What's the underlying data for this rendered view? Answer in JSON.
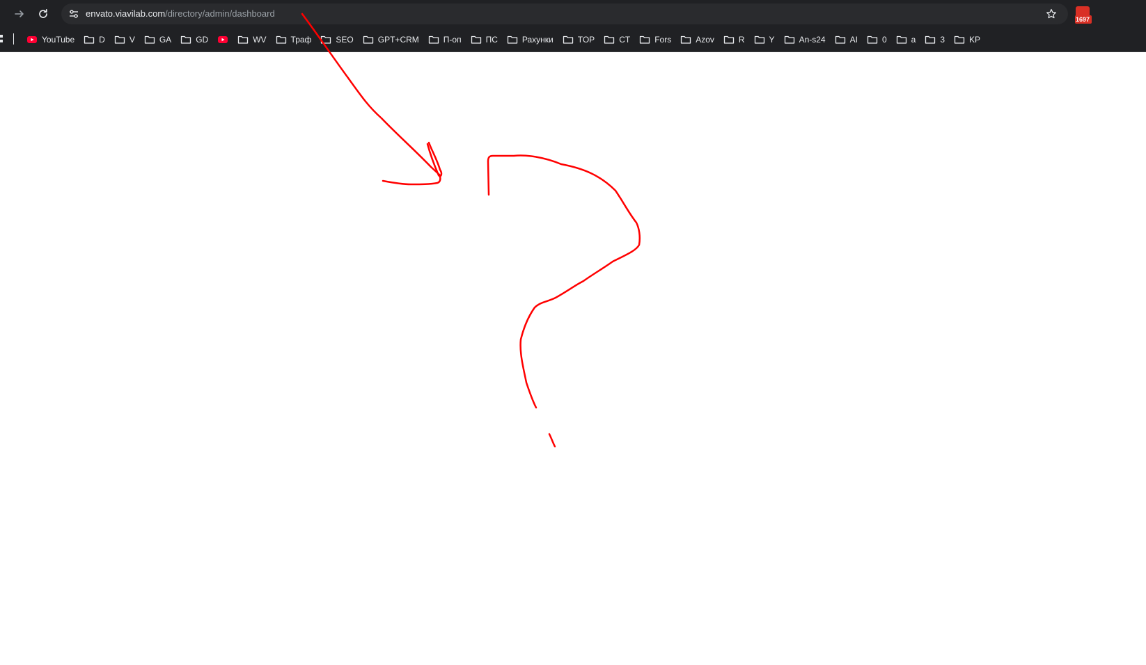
{
  "browser": {
    "url_host": "envato.viavilab.com",
    "url_path": "/directory/admin/dashboard",
    "extension_badge": "1697"
  },
  "icons": {
    "forward": "arrow-forward-icon",
    "reload": "reload-icon",
    "site_info": "tune-icon",
    "bookmark": "star-outline-icon",
    "extension": "extension-icon",
    "apps": "apps-icon",
    "folder": "folder-icon",
    "youtube": "youtube-icon"
  },
  "bookmarks": [
    {
      "label": "YouTube",
      "icon": "youtube"
    },
    {
      "label": "D",
      "icon": "folder"
    },
    {
      "label": "V",
      "icon": "folder"
    },
    {
      "label": "GA",
      "icon": "folder"
    },
    {
      "label": "GD",
      "icon": "folder"
    },
    {
      "label": "",
      "icon": "youtube"
    },
    {
      "label": "WV",
      "icon": "folder"
    },
    {
      "label": "Траф",
      "icon": "folder"
    },
    {
      "label": "SEO",
      "icon": "folder"
    },
    {
      "label": "GPT+CRM",
      "icon": "folder"
    },
    {
      "label": "П-оп",
      "icon": "folder"
    },
    {
      "label": "ПС",
      "icon": "folder"
    },
    {
      "label": "Рахунки",
      "icon": "folder"
    },
    {
      "label": "TOP",
      "icon": "folder"
    },
    {
      "label": "CT",
      "icon": "folder"
    },
    {
      "label": "Fors",
      "icon": "folder"
    },
    {
      "label": "Azov",
      "icon": "folder"
    },
    {
      "label": "R",
      "icon": "folder"
    },
    {
      "label": "Y",
      "icon": "folder"
    },
    {
      "label": "An-s24",
      "icon": "folder"
    },
    {
      "label": "AI",
      "icon": "folder"
    },
    {
      "label": "0",
      "icon": "folder"
    },
    {
      "label": "a",
      "icon": "folder"
    },
    {
      "label": "3",
      "icon": "folder"
    },
    {
      "label": "KP",
      "icon": "folder"
    }
  ],
  "colors": {
    "toolbar": "#202124",
    "annotation": "#ff0000",
    "youtube": "#ff0033"
  }
}
